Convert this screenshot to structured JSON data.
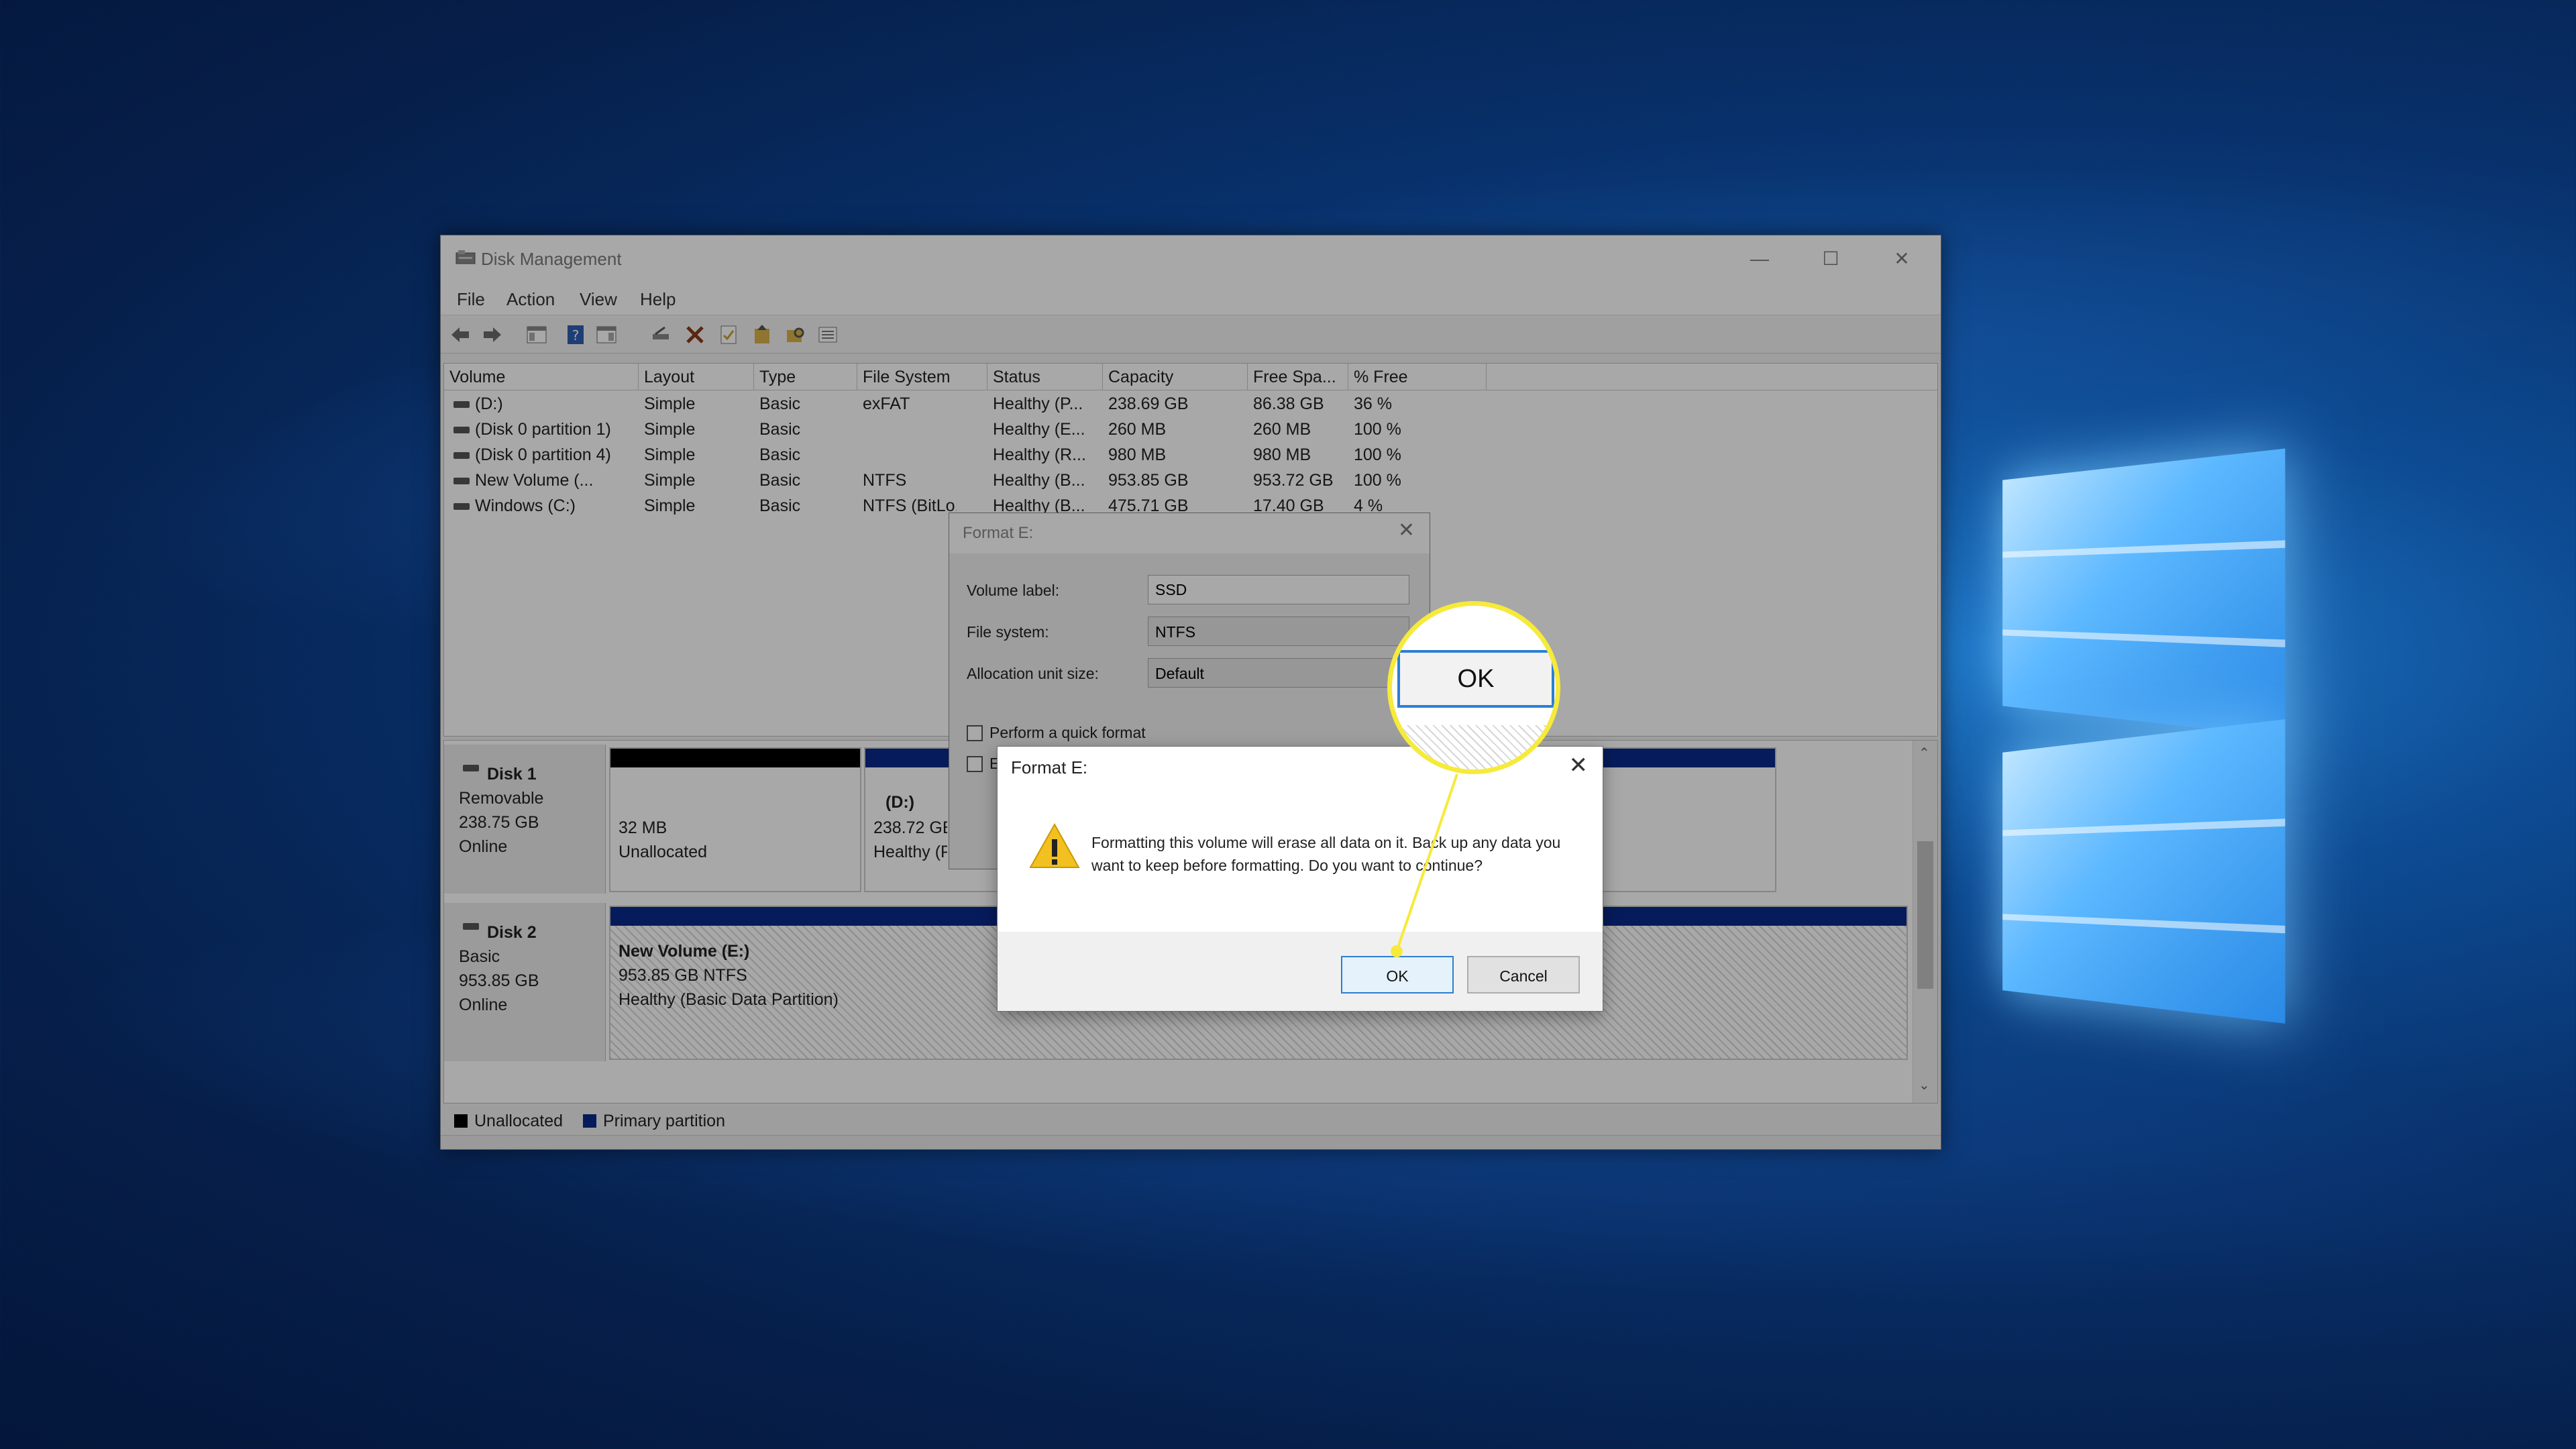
{
  "window": {
    "title": "Disk Management"
  },
  "menu": [
    "File",
    "Action",
    "View",
    "Help"
  ],
  "volume_list": {
    "headers": [
      "Volume",
      "Layout",
      "Type",
      "File System",
      "Status",
      "Capacity",
      "Free Spa...",
      "% Free"
    ],
    "rows": [
      [
        "(D:)",
        "Simple",
        "Basic",
        "exFAT",
        "Healthy (P...",
        "238.69 GB",
        "86.38 GB",
        "36 %"
      ],
      [
        "(Disk 0 partition 1)",
        "Simple",
        "Basic",
        "",
        "Healthy (E...",
        "260 MB",
        "260 MB",
        "100 %"
      ],
      [
        "(Disk 0 partition 4)",
        "Simple",
        "Basic",
        "",
        "Healthy (R...",
        "980 MB",
        "980 MB",
        "100 %"
      ],
      [
        "New Volume (...",
        "Simple",
        "Basic",
        "NTFS",
        "Healthy (B...",
        "953.85 GB",
        "953.72 GB",
        "100 %"
      ],
      [
        "Windows (C:)",
        "Simple",
        "Basic",
        "NTFS (BitLo...",
        "Healthy (B...",
        "475.71 GB",
        "17.40 GB",
        "4 %"
      ]
    ]
  },
  "disks": [
    {
      "name": "Disk 1",
      "kind": "Removable",
      "size": "238.75 GB",
      "state": "Online",
      "partitions": [
        {
          "size": "32 MB",
          "status": "Unallocated"
        },
        {
          "name": "(D:)",
          "size": "238.72 GB",
          "status": "Healthy (P..."
        }
      ]
    },
    {
      "name": "Disk 2",
      "kind": "Basic",
      "size": "953.85 GB",
      "state": "Online",
      "partitions": [
        {
          "name": "New Volume  (E:)",
          "size": "953.85 GB NTFS",
          "status": "Healthy (Basic Data Partition)"
        }
      ]
    }
  ],
  "legend": [
    "Unallocated",
    "Primary partition"
  ],
  "format_dialog": {
    "title": "Format E:",
    "volume_label_caption": "Volume label:",
    "volume_label_value": "SSD",
    "file_system_caption": "File system:",
    "file_system_value": "NTFS",
    "allocation_caption": "Allocation unit size:",
    "allocation_value": "Default",
    "quick_format_label": "Perform a quick format",
    "second_checkbox_label": "E"
  },
  "warning_dialog": {
    "title": "Format E:",
    "message": "Formatting this volume will erase all data on it. Back up any data you want to keep before formatting. Do you want to continue?",
    "ok_label": "OK",
    "cancel_label": "Cancel"
  },
  "callout": {
    "label": "OK"
  },
  "colors": {
    "primary_partition": "#0a2a8a",
    "unallocated": "#000000",
    "callout_ring": "#f6ea3b",
    "focus_border": "#2b7fd3"
  }
}
